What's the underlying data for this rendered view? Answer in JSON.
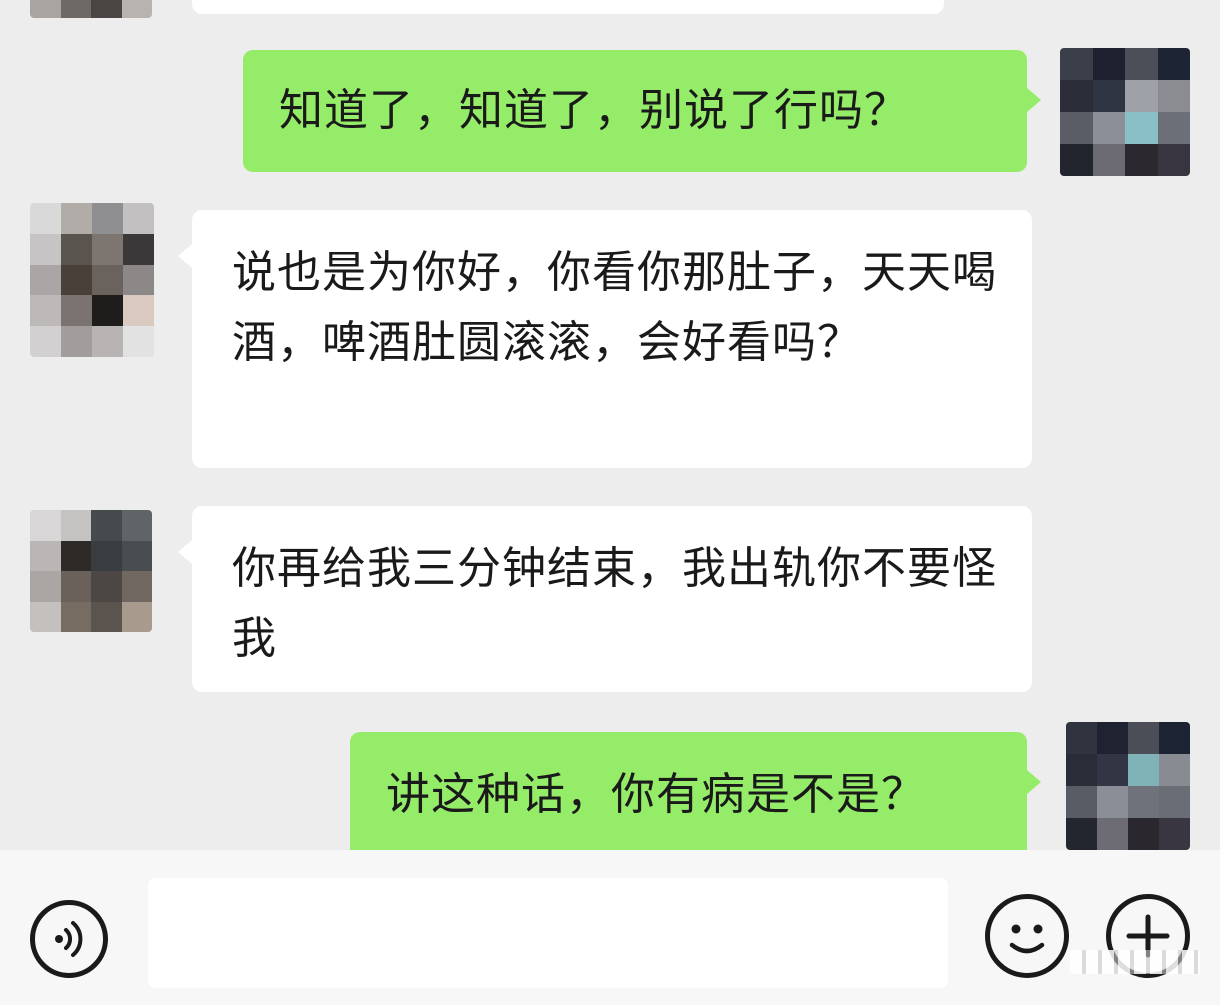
{
  "messages": [
    {
      "side": "in",
      "text": ""
    },
    {
      "side": "out",
      "text": "知道了，知道了，别说了行吗？"
    },
    {
      "side": "in",
      "text": "说也是为你好，你看你那肚子，天天喝酒，啤酒肚圆滚滚，会好看吗？"
    },
    {
      "side": "in",
      "text": "你再给我三分钟结束，我出轨你不要怪我"
    },
    {
      "side": "out",
      "text": "讲这种话，你有病是不是？"
    }
  ],
  "colors": {
    "background": "#ededed",
    "incoming_bubble": "#ffffff",
    "outgoing_bubble": "#95ec69",
    "input_bar": "#f7f7f7",
    "text": "#1a1a1a"
  },
  "icons": {
    "voice": "voice-icon",
    "emoji": "emoji-icon",
    "plus": "plus-icon"
  }
}
